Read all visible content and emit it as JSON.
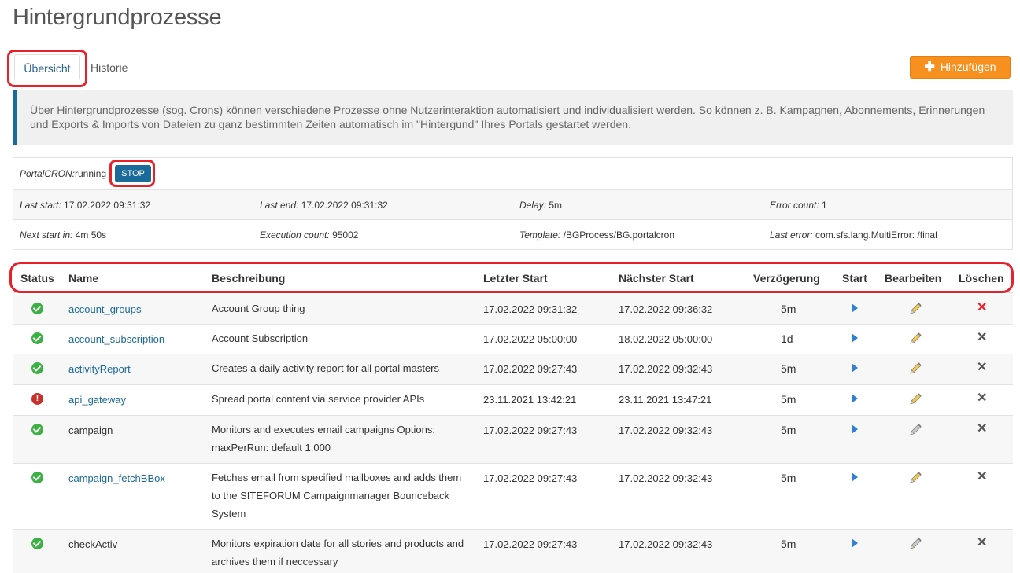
{
  "page": {
    "title": "Hintergrundprozesse"
  },
  "tabs": [
    {
      "label": "Übersicht"
    },
    {
      "label": "Historie"
    }
  ],
  "add_button": {
    "label": "Hinzufügen",
    "icon": "plus-icon"
  },
  "info_text": "Über Hintergrundprozesse (sog. Crons) können verschiedene Prozesse ohne Nutzerinteraktion automatisiert und individualisiert werden. So können z. B. Kampagnen, Abonnements, Erinnerungen und Exports & Imports von Dateien zu ganz bestimmten Zeiten automatisch im \"Hintergund\" Ihres Portals gestartet werden.",
  "cron": {
    "status_label": "PortalCRON:",
    "status_value": "running",
    "stop_label": "STOP",
    "last_start_label": "Last start:",
    "last_start": "17.02.2022 09:31:32",
    "last_end_label": "Last end:",
    "last_end": "17.02.2022 09:31:32",
    "delay_label": "Delay:",
    "delay": "5m",
    "error_count_label": "Error count:",
    "error_count": "1",
    "next_start_label": "Next start in:",
    "next_start": "4m 50s",
    "execution_count_label": "Execution count:",
    "execution_count": "95002",
    "template_label": "Template:",
    "template": "/BGProcess/BG.portalcron",
    "last_error_label": "Last error:",
    "last_error": "com.sfs.lang.MultiError: /final"
  },
  "table": {
    "headers": {
      "status": "Status",
      "name": "Name",
      "description": "Beschreibung",
      "last_start": "Letzter Start",
      "next_start": "Nächster Start",
      "delay": "Verzögerung",
      "start": "Start",
      "edit": "Bearbeiten",
      "delete": "Löschen"
    },
    "rows": [
      {
        "status": "ok",
        "name": "account_groups",
        "linked": true,
        "description": "Account Group thing",
        "last_start": "17.02.2022 09:31:32",
        "next_start": "17.02.2022 09:36:32",
        "delay": "5m",
        "editable": true,
        "delete_active": true
      },
      {
        "status": "ok",
        "name": "account_subscription",
        "linked": true,
        "description": "Account Subscription",
        "last_start": "17.02.2022 05:00:00",
        "next_start": "18.02.2022 05:00:00",
        "delay": "1d",
        "editable": true,
        "delete_active": false
      },
      {
        "status": "ok",
        "name": "activityReport",
        "linked": true,
        "description": "Creates a daily activity report for all portal masters",
        "last_start": "17.02.2022 09:27:43",
        "next_start": "17.02.2022 09:32:43",
        "delay": "5m",
        "editable": true,
        "delete_active": false
      },
      {
        "status": "error",
        "name": "api_gateway",
        "linked": true,
        "description": "Spread portal content via service provider APIs",
        "last_start": "23.11.2021 13:42:21",
        "next_start": "23.11.2021 13:47:21",
        "delay": "5m",
        "editable": true,
        "delete_active": false
      },
      {
        "status": "ok",
        "name": "campaign",
        "linked": false,
        "description": "Monitors and executes email campaigns Options: maxPerRun: default 1.000",
        "last_start": "17.02.2022 09:27:43",
        "next_start": "17.02.2022 09:32:43",
        "delay": "5m",
        "editable": false,
        "delete_active": false
      },
      {
        "status": "ok",
        "name": "campaign_fetchBBox",
        "linked": true,
        "description": "Fetches email from specified mailboxes and adds them to the SITEFORUM Campaignmanager Bounceback System",
        "last_start": "17.02.2022 09:27:43",
        "next_start": "17.02.2022 09:32:43",
        "delay": "5m",
        "editable": true,
        "delete_active": false
      },
      {
        "status": "ok",
        "name": "checkActiv",
        "linked": false,
        "description": "Monitors expiration date for all stories and products and archives them if neccessary",
        "last_start": "17.02.2022 09:27:43",
        "next_start": "17.02.2022 09:32:43",
        "delay": "5m",
        "editable": false,
        "delete_active": false
      }
    ]
  },
  "colors": {
    "accent": "#1a6a9a",
    "orange": "#f7901e",
    "ok": "#3cb043",
    "error": "#c9302c",
    "annotation": "#e8202a"
  }
}
